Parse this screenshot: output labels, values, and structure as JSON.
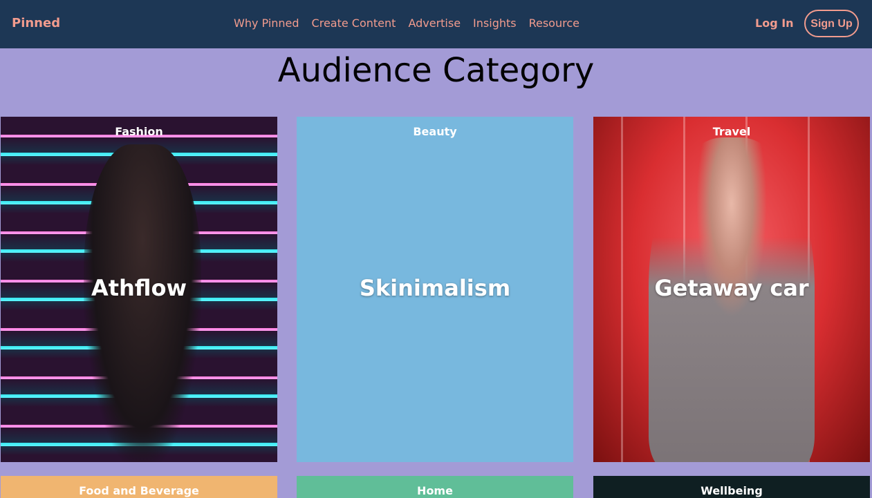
{
  "nav": {
    "brand": "Pinned",
    "links": [
      "Why Pinned",
      "Create Content",
      "Advertise",
      "Insights",
      "Resource"
    ],
    "login": "Log In",
    "signup": "Sign Up"
  },
  "page": {
    "title": "Audience Category"
  },
  "cards": [
    {
      "category": "Fashion",
      "trend": "Athflow"
    },
    {
      "category": "Beauty",
      "trend": "Skinimalism"
    },
    {
      "category": "Travel",
      "trend": "Getaway car"
    },
    {
      "category": "Food and Beverage"
    },
    {
      "category": "Home"
    },
    {
      "category": "Wellbeing"
    }
  ],
  "colors": {
    "nav_bg": "#1d3755",
    "accent": "#f29c8e",
    "page_bg": "#a39bd6",
    "beauty": "#78b8de",
    "food": "#f0b570",
    "home": "#60be98",
    "wellbeing": "#0f1f22"
  }
}
